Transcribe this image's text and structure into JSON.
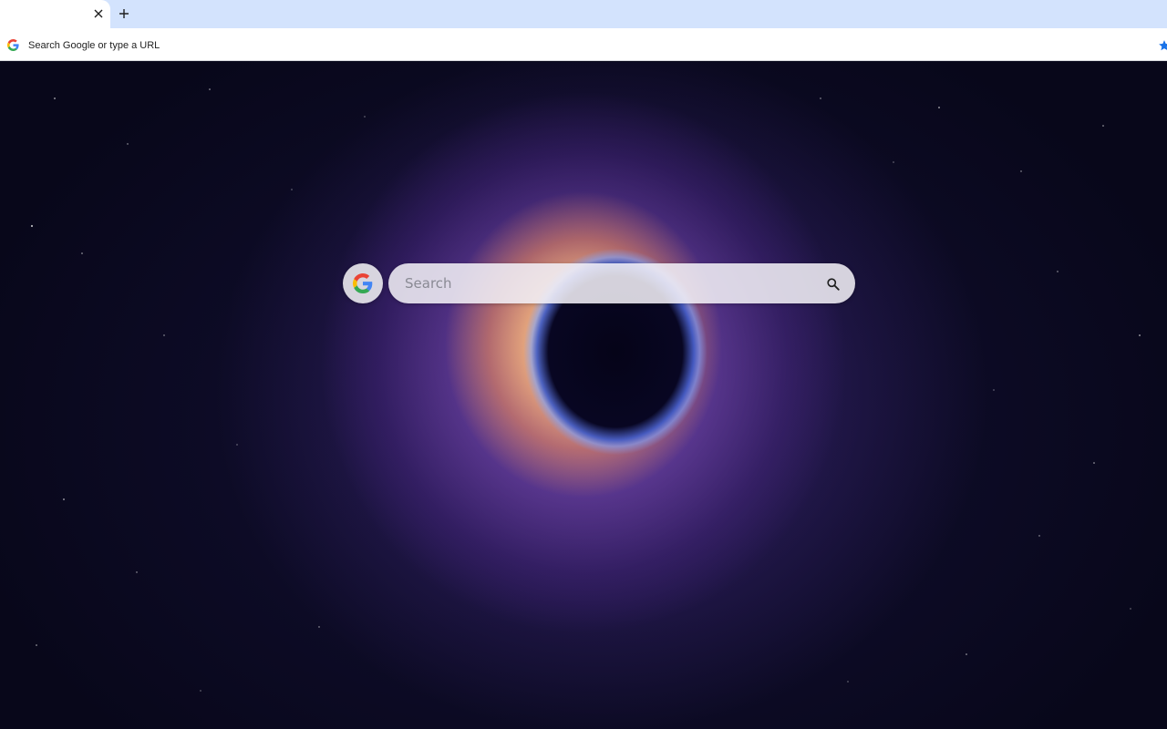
{
  "browser": {
    "tab": {
      "title": "",
      "close_label": "×"
    },
    "new_tab_label": "+",
    "omnibox": {
      "text": "Search Google or type a URL"
    }
  },
  "search": {
    "placeholder": "Search"
  },
  "colors": {
    "tabstrip": "#d3e3fd",
    "toolbar": "#ffffff",
    "accent_star": "#1a73e8"
  }
}
